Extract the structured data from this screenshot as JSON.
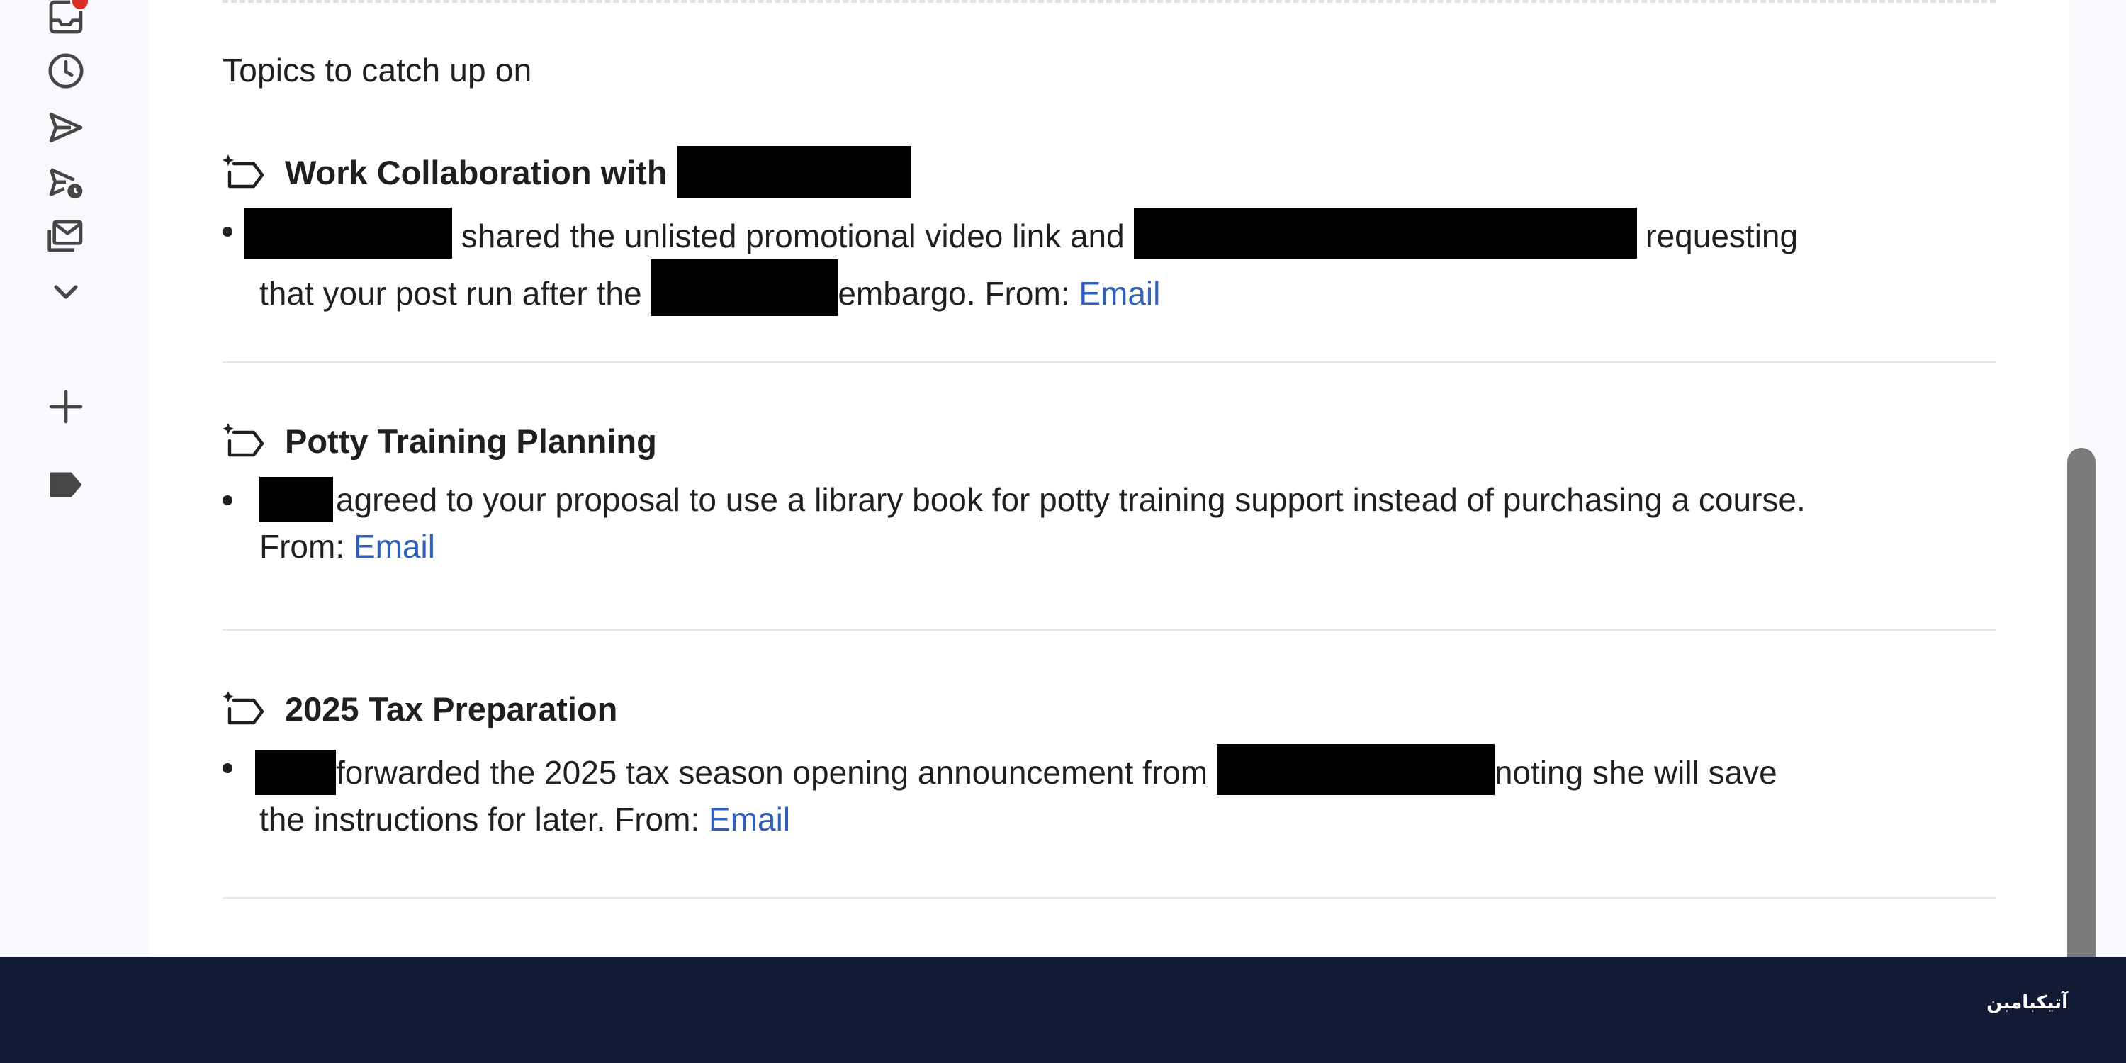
{
  "summary": {
    "section_title": "Topics to catch up on"
  },
  "topics": [
    {
      "title": "Work Collaboration with",
      "text_a": " shared the unlisted promotional video link and ",
      "text_b": " requesting that your post run after the ",
      "text_c": "embargo. From: ",
      "link": "Email"
    },
    {
      "title": "Potty Training Planning",
      "text_a": "agreed to your proposal to use a library book for potty training support instead of purchasing a course. From: ",
      "link": "Email"
    },
    {
      "title": "2025 Tax Preparation",
      "text_a": "forwarded the 2025 tax season opening announcement from ",
      "text_b": "noting she will save the instructions for later. From: ",
      "link": "Email"
    }
  ],
  "rail": {
    "icons": [
      "inbox-icon",
      "clock-icon",
      "send-icon",
      "scheduled-send-icon",
      "all-mail-icon",
      "chevron-down-icon",
      "plus-icon",
      "label-icon"
    ]
  },
  "taskbar": {
    "logo_text": "آتیکبامبن"
  },
  "colors": {
    "link": "#2f5fb8",
    "badge": "#d93025",
    "taskbar": "#131a33",
    "scrollbar_thumb": "#7b7b7b"
  }
}
